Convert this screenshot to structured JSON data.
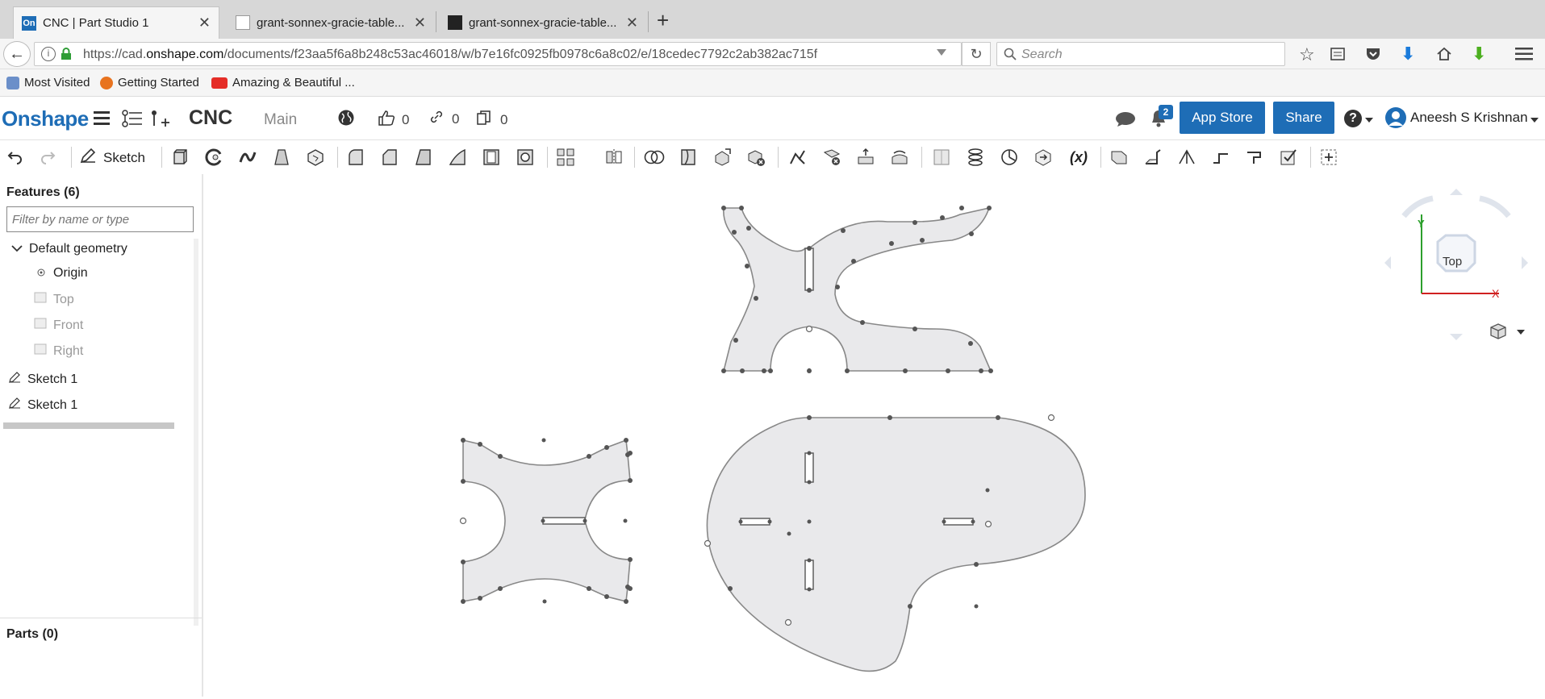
{
  "browser": {
    "tabs": [
      {
        "title": "CNC | Part Studio 1",
        "favicon": "On"
      },
      {
        "title": "grant-sonnex-gracie-table..."
      },
      {
        "title": "grant-sonnex-gracie-table..."
      }
    ],
    "url_prefix": "https://cad.",
    "url_domain": "onshape.com",
    "url_path": "/documents/f23aa5f6a8b248c53ac46018/w/b7e16fc0925fb0978c6a8c02/e/18cedec7792c2ab382ac715f",
    "search_placeholder": "Search",
    "bookmarks": [
      "Most Visited",
      "Getting Started",
      "Amazing & Beautiful ..."
    ]
  },
  "app": {
    "logo": "Onshape",
    "document_name": "CNC",
    "branch": "Main",
    "likes": "0",
    "links": "0",
    "copies": "0",
    "notifications": "2",
    "app_store_label": "App Store",
    "share_label": "Share",
    "user_name": "Aneesh S Krishnan",
    "brand_color": "#1e6db6"
  },
  "toolbar": {
    "sketch_label": "Sketch",
    "variable_label": "(x)"
  },
  "features": {
    "title": "Features (6)",
    "filter_placeholder": "Filter by name or type",
    "default_geometry": "Default geometry",
    "items": [
      "Origin",
      "Top",
      "Front",
      "Right"
    ],
    "sketches": [
      "Sketch 1",
      "Sketch 1"
    ]
  },
  "parts": {
    "title": "Parts (0)"
  },
  "view_cube": {
    "face": "Top",
    "axis_y": "Y",
    "axis_x": "X"
  }
}
